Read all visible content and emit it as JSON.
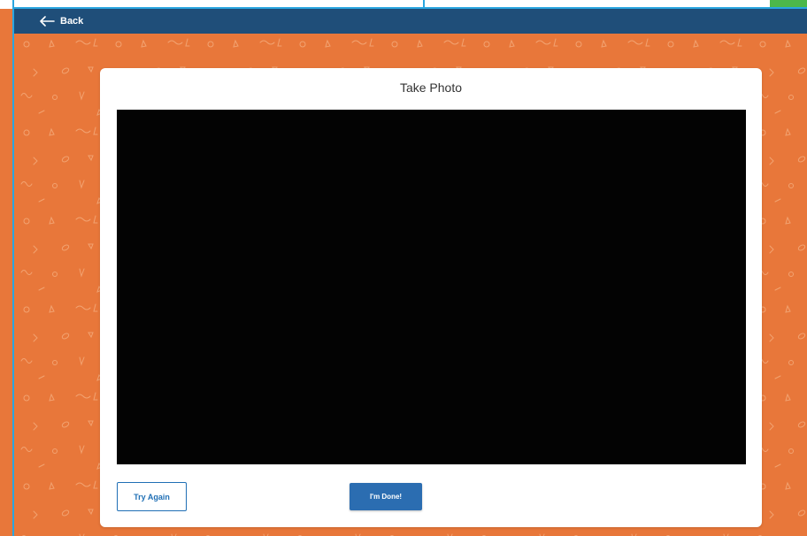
{
  "nav": {
    "back_label": "Back",
    "back_icon": "arrow-left-icon"
  },
  "card": {
    "title": "Take Photo"
  },
  "actions": {
    "try_again_label": "Try Again",
    "done_label": "I'm Done!"
  },
  "colors": {
    "background": "#e8773a",
    "topbar": "#1f4e79",
    "window_border": "#2aa6e0",
    "primary_button": "#2b6db1",
    "preview": "#030303"
  }
}
